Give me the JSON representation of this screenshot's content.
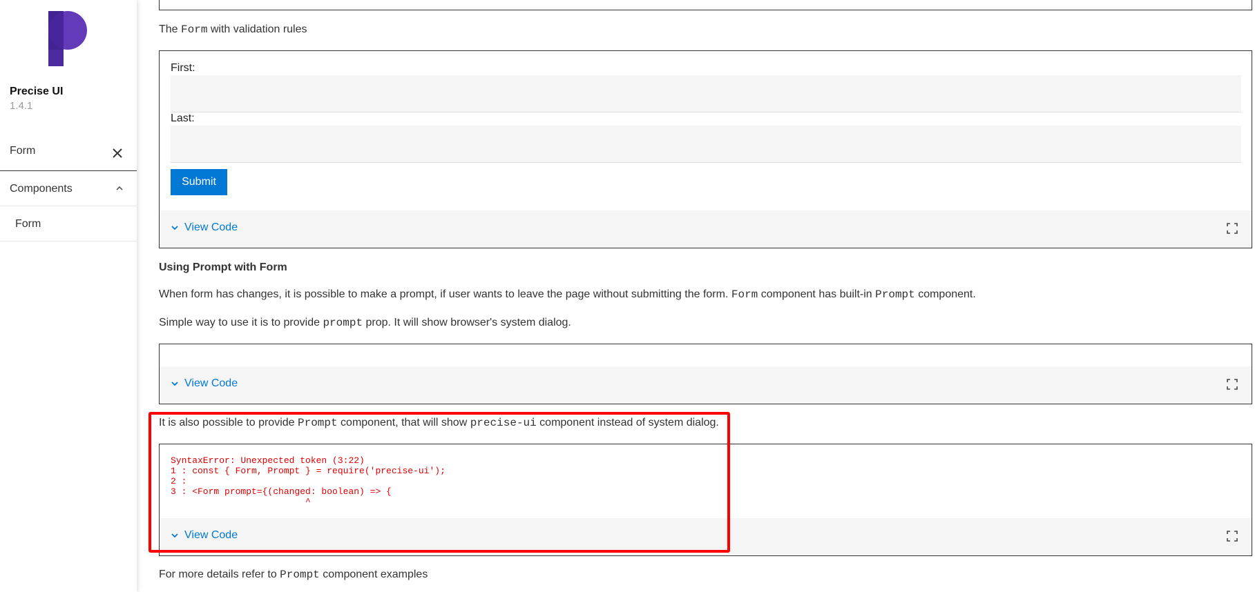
{
  "sidebar": {
    "brand_name": "Precise UI",
    "version": "1.4.1",
    "search_value": "Form",
    "nav": {
      "components_label": "Components",
      "form_label": "Form"
    }
  },
  "main": {
    "intro_text": {
      "before": "The ",
      "code": "Form",
      "after": " with validation rules"
    },
    "form_example": {
      "first_label": "First:",
      "last_label": "Last:",
      "submit_label": "Submit"
    },
    "view_code_label": "View Code",
    "section_heading": "Using Prompt with Form",
    "para1": {
      "a": "When form has changes, it is possible to make a prompt, if user wants to leave the page without submitting the form. ",
      "code1": "Form",
      "b": " component has built-in ",
      "code2": "Prompt",
      "c": " component."
    },
    "para2": {
      "a": "Simple way to use it is to provide ",
      "code": "prompt",
      "b": " prop. It will show browser's system dialog."
    },
    "para3": {
      "a": "It is also possible to provide ",
      "code1": "Prompt",
      "b": " component, that will show ",
      "code2": "precise-ui",
      "c": " component instead of system dialog."
    },
    "error_text": "SyntaxError: Unexpected token (3:22)\n1 : const { Form, Prompt } = require('precise-ui');\n2 : \n3 : <Form prompt={(changed: boolean) => {\n                         ^",
    "para4": {
      "a": "For more details refer to ",
      "code": "Prompt",
      "b": " component examples"
    }
  },
  "colors": {
    "accent": "#0078d4",
    "error": "#e00000",
    "highlight": "#ff0000",
    "logo": "#5b2fb5"
  }
}
